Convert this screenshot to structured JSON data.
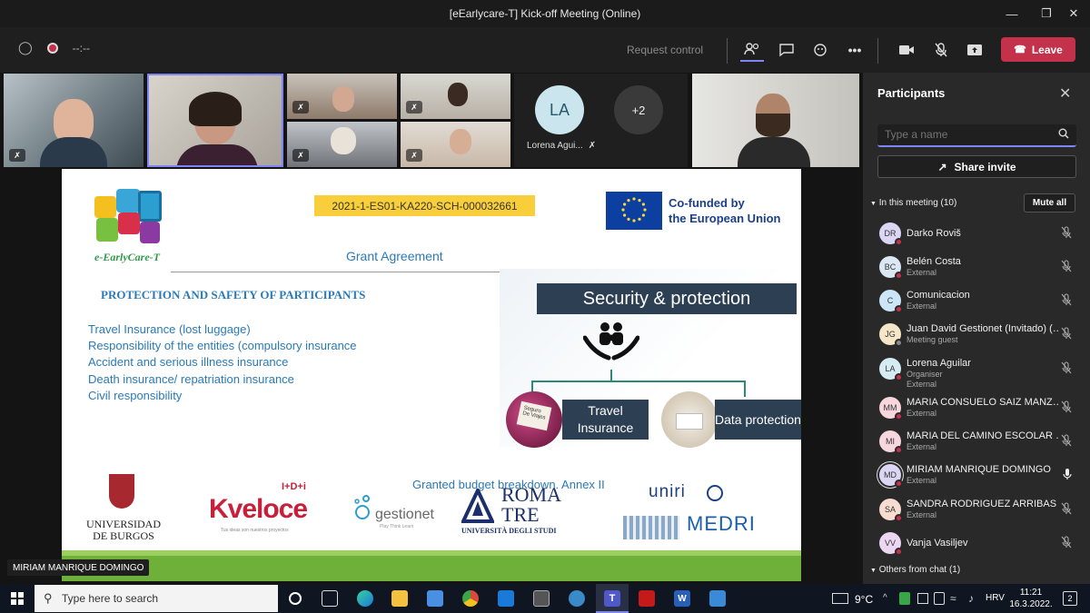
{
  "window": {
    "title": "[eEarlycare-T] Kick-off Meeting (Online)"
  },
  "toolbar": {
    "timer": "--:--",
    "request_control": "Request control",
    "leave_label": "Leave"
  },
  "video_tiles": {
    "avatar_initials": "LA",
    "avatar_name": "Lorena Agui...",
    "overflow_count": "+2",
    "spotlight_name": "MIRIAM MANRIQUE DOMINGO"
  },
  "slide": {
    "project_code": "2021-1-ES01-KA220-SCH-000032661",
    "eu_label_line1": "Co-funded by",
    "eu_label_line2": "the European Union",
    "logo_caption": "e-EarlyCare-T",
    "grant_agreement": "Grant Agreement",
    "section_heading": "PROTECTION AND SAFETY OF PARTICIPANTS",
    "items": [
      "Travel Insurance (lost luggage)",
      "Responsibility of the entities (compulsory insurance",
      "Accident and serious illness insurance",
      "Death insurance/ repatriation insurance",
      "Civil responsibility"
    ],
    "security_title": "Security & protection",
    "box_travel": "Travel Insurance",
    "box_data": "Data protection",
    "budget_note": "Granted budget breakdown. Annex II",
    "partner_logos": {
      "burgos_line1": "UNIVERSIDAD",
      "burgos_line2": "DE BURGOS",
      "kveloce": "Kveloce",
      "kveloce_sup": "I+D+i",
      "kveloce_tag": "Tus ideas son nuestros proyectos",
      "gestionet": "gestionet",
      "gestionet_tag": "Play Think Learn",
      "roma_line1": "ROMA",
      "roma_line2": "TRE",
      "roma_line3": "UNIVERSITÀ DEGLI STUDI",
      "uniri": "uniri",
      "medri": "MEDRI"
    }
  },
  "participants_panel": {
    "title": "Participants",
    "search_placeholder": "Type a name",
    "share_invite": "Share invite",
    "in_meeting": "In this meeting (10)",
    "mute_all": "Mute all",
    "others_chat": "Others from chat (1)",
    "people": [
      {
        "initials": "DR",
        "name": "Darko Roviš",
        "role": "",
        "color": "#dcd6f5"
      },
      {
        "initials": "BC",
        "name": "Belén Costa",
        "role": "External",
        "color": "#dbe7f3"
      },
      {
        "initials": "C",
        "name": "Comunicacion",
        "role": "External",
        "color": "#cde6f7"
      },
      {
        "initials": "JG",
        "name": "Juan David Gestionet (Invitado) (…",
        "role": "Meeting guest",
        "color": "#f5e6c8"
      },
      {
        "initials": "LA",
        "name": "Lorena Aguilar",
        "role": "Organiser",
        "role2": "External",
        "color": "#d5ecf2"
      },
      {
        "initials": "MM",
        "name": "MARIA CONSUELO SAIZ MANZ…",
        "role": "External",
        "color": "#f7d6de"
      },
      {
        "initials": "MI",
        "name": "MARIA DEL CAMINO ESCOLAR …",
        "role": "External",
        "color": "#f7d6de"
      },
      {
        "initials": "MD",
        "name": "MIRIAM MANRIQUE DOMINGO",
        "role": "External",
        "color": "#dcd6f5"
      },
      {
        "initials": "SA",
        "name": "SANDRA RODRIGUEZ ARRIBAS",
        "role": "External",
        "color": "#f7dcd2"
      },
      {
        "initials": "VV",
        "name": "Vanja Vasiljev",
        "role": "",
        "color": "#ecd6f2"
      }
    ]
  },
  "taskbar": {
    "search_placeholder": "Type here to search",
    "weather": "9°C",
    "language": "HRV",
    "time": "11:21",
    "date": "16.3.2022.",
    "notifications": "2"
  }
}
